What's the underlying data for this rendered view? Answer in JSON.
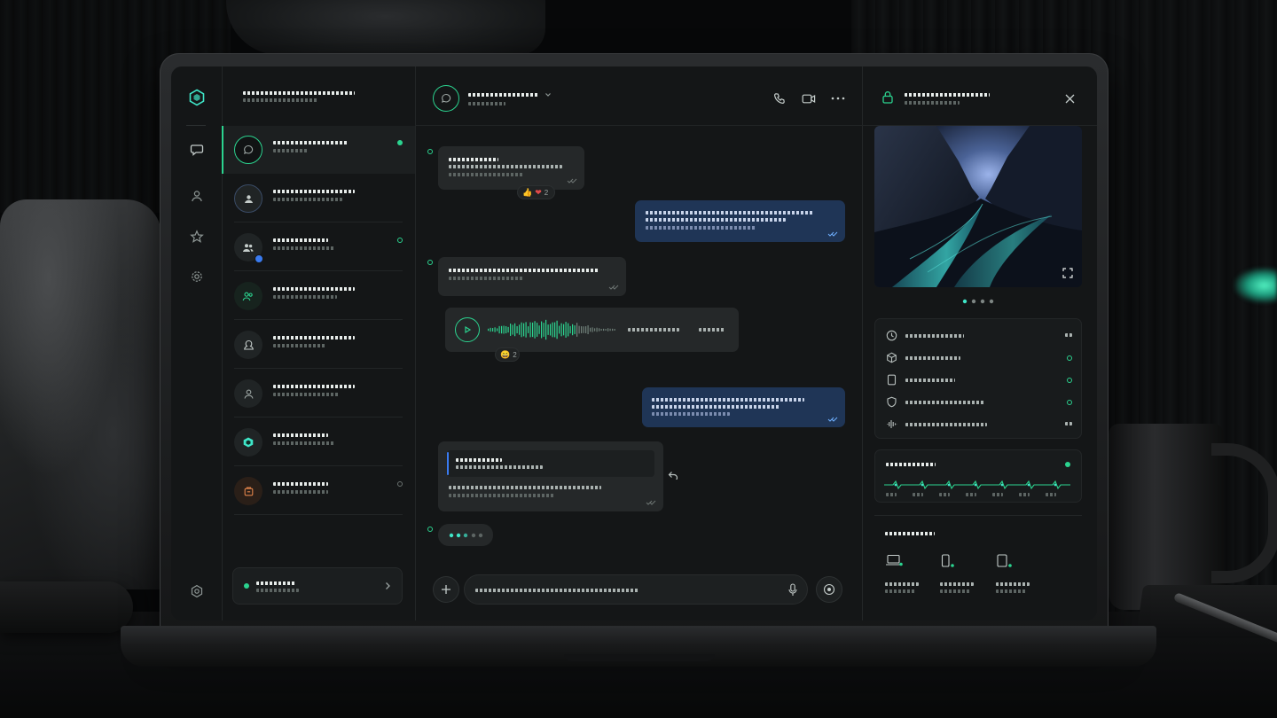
{
  "colors": {
    "accent": "#2bd38f",
    "teal": "#3fe6c8",
    "outgoing_bubble": "#1f3556",
    "incoming_bubble": "#252829",
    "badge_blue": "#3a7bf0",
    "online": "#2bd38f"
  },
  "icons": {
    "rail": [
      "logo-hexagon-icon",
      "chat-bubble-icon",
      "user-icon",
      "star-icon",
      "settings-gear-icon"
    ],
    "chat_header": [
      "phone-icon",
      "video-camera-icon",
      "more-dots-icon"
    ],
    "details_header": [
      "lock-icon",
      "close-icon"
    ],
    "composer": [
      "plus-icon",
      "microphone-icon",
      "record-icon"
    ],
    "details_rows": [
      "clock-icon",
      "cube-icon",
      "tablet-icon",
      "shield-icon",
      "waveform-icon"
    ],
    "devices": [
      "laptop-icon",
      "phone-device-icon",
      "tablet-device-icon"
    ]
  },
  "list": {
    "header_line1": "••••••••••••••••••••",
    "header_line2": "••••••••••••••••",
    "conversations": [
      {
        "name": "••••••••••••••••",
        "preview": "••••••••",
        "status": "online"
      },
      {
        "name": "••••••••••••••••",
        "preview": "••••••••••••••",
        "status": "none"
      },
      {
        "name": "••••••••••••",
        "preview": "••••••••••••••",
        "status": "away"
      },
      {
        "name": "••••••••••••••••",
        "preview": "••••••••••••••",
        "status": "none"
      },
      {
        "name": "••••••••••••••••",
        "preview": "••••••••••••",
        "status": "none"
      },
      {
        "name": "••••••••••••••••",
        "preview": "••••••••••••••",
        "status": "none"
      },
      {
        "name": "••••••••••••",
        "preview": "••••••••••••",
        "status": "none"
      },
      {
        "name": "••••••••••••••",
        "preview": "••••••••••••",
        "status": "offline"
      }
    ],
    "account_name": "•••••••••••",
    "account_sub": "•••••••••••••"
  },
  "chat": {
    "title": "••••••••••••••",
    "subtitle": "••••••••••",
    "messages": {
      "m1_line1": "••••••••••••••",
      "m1_line2": "•••••••••••••••••••••",
      "m1_line3": "••••••••••••••",
      "m1_reaction_count": "2",
      "m2_line1": "•••••••••••••••••••••••••••••••••••",
      "m2_line2": "••••••••••••••••••••••••••••••",
      "m2_line3": "••••••••••••••••••••••••",
      "m3_line1": "••••••••••••••••••••••••••••••••",
      "m3_line2": "••••••••••••••••",
      "voice_label": "••••••••••••",
      "voice_time": "••••••",
      "voice_reaction_count": "2",
      "m4_line1": "•••••••••••••••••••••••••••••",
      "m4_line2": "•••••••••••••••••••••••••",
      "m4_line3": "•••••••••••••••",
      "quote_name": "•••••••••••",
      "quote_text": "•••••••••••••••",
      "m5_line1": "••••••••••••••••••••••••••••••",
      "m5_line2": "•••••••••••••••••••••••"
    },
    "composer_placeholder": "•••••••••••••••••••••••••••••••••••••••"
  },
  "details": {
    "title": "••••••••••••••••••••",
    "subtitle": "••••••••••••••",
    "rows": [
      {
        "label": "•••••••••••••••",
        "value": "••"
      },
      {
        "label": "••••••••••••••",
        "value": "online"
      },
      {
        "label": "••••••••••••",
        "value": "online"
      },
      {
        "label": "••••••••••••••••••••",
        "value": "online"
      },
      {
        "label": "••••••••••••••••••••",
        "value": "••"
      }
    ],
    "activity_title": "•••••••••••••",
    "activity_ticks": [
      "•••",
      "•••",
      "•••",
      "•••",
      "•••",
      "•••",
      "•••"
    ],
    "devices_title": "•••••••••••",
    "devices": [
      {
        "line1": "••••••••••",
        "line2": "•••••••••"
      },
      {
        "line1": "••••••••••",
        "line2": "•••••••••"
      },
      {
        "line1": "••••••••••",
        "line2": "•••••••••"
      }
    ]
  }
}
